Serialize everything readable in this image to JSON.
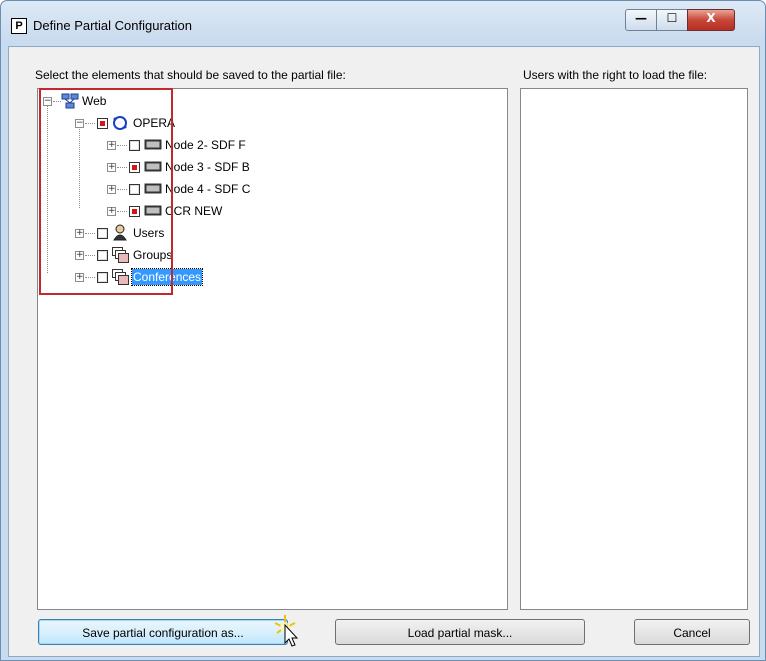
{
  "window": {
    "icon_letter": "P",
    "title": "Define Partial Configuration",
    "minimize_glyph": "—",
    "maximize_glyph": "☐",
    "close_glyph": "X"
  },
  "left_panel": {
    "label": "Select the elements that should be saved to the partial file:",
    "tree": [
      {
        "label": "Web",
        "checked": false,
        "icon": "network-icon"
      },
      {
        "label": "OPERA",
        "checked": true,
        "icon": "globe-node-icon"
      },
      {
        "label": "Node 2- SDF F",
        "checked": false,
        "icon": "device-icon"
      },
      {
        "label": "Node 3 - SDF B",
        "checked": true,
        "icon": "device-icon"
      },
      {
        "label": "Node 4 - SDF C",
        "checked": false,
        "icon": "device-icon"
      },
      {
        "label": "CCR NEW",
        "checked": true,
        "icon": "device-icon"
      },
      {
        "label": "Users",
        "checked": false,
        "icon": "user-icon"
      },
      {
        "label": "Groups",
        "checked": false,
        "icon": "group-icon"
      },
      {
        "label": "Conferences",
        "checked": false,
        "icon": "group-icon",
        "selected": true
      }
    ]
  },
  "right_panel": {
    "label": "Users with the right to load the file:"
  },
  "buttons": {
    "save": "Save partial configuration as...",
    "load": "Load partial mask...",
    "cancel": "Cancel"
  },
  "colors": {
    "highlight": "#3399ff",
    "annotation_box": "#c0292e",
    "checked": "#e41b1b"
  }
}
